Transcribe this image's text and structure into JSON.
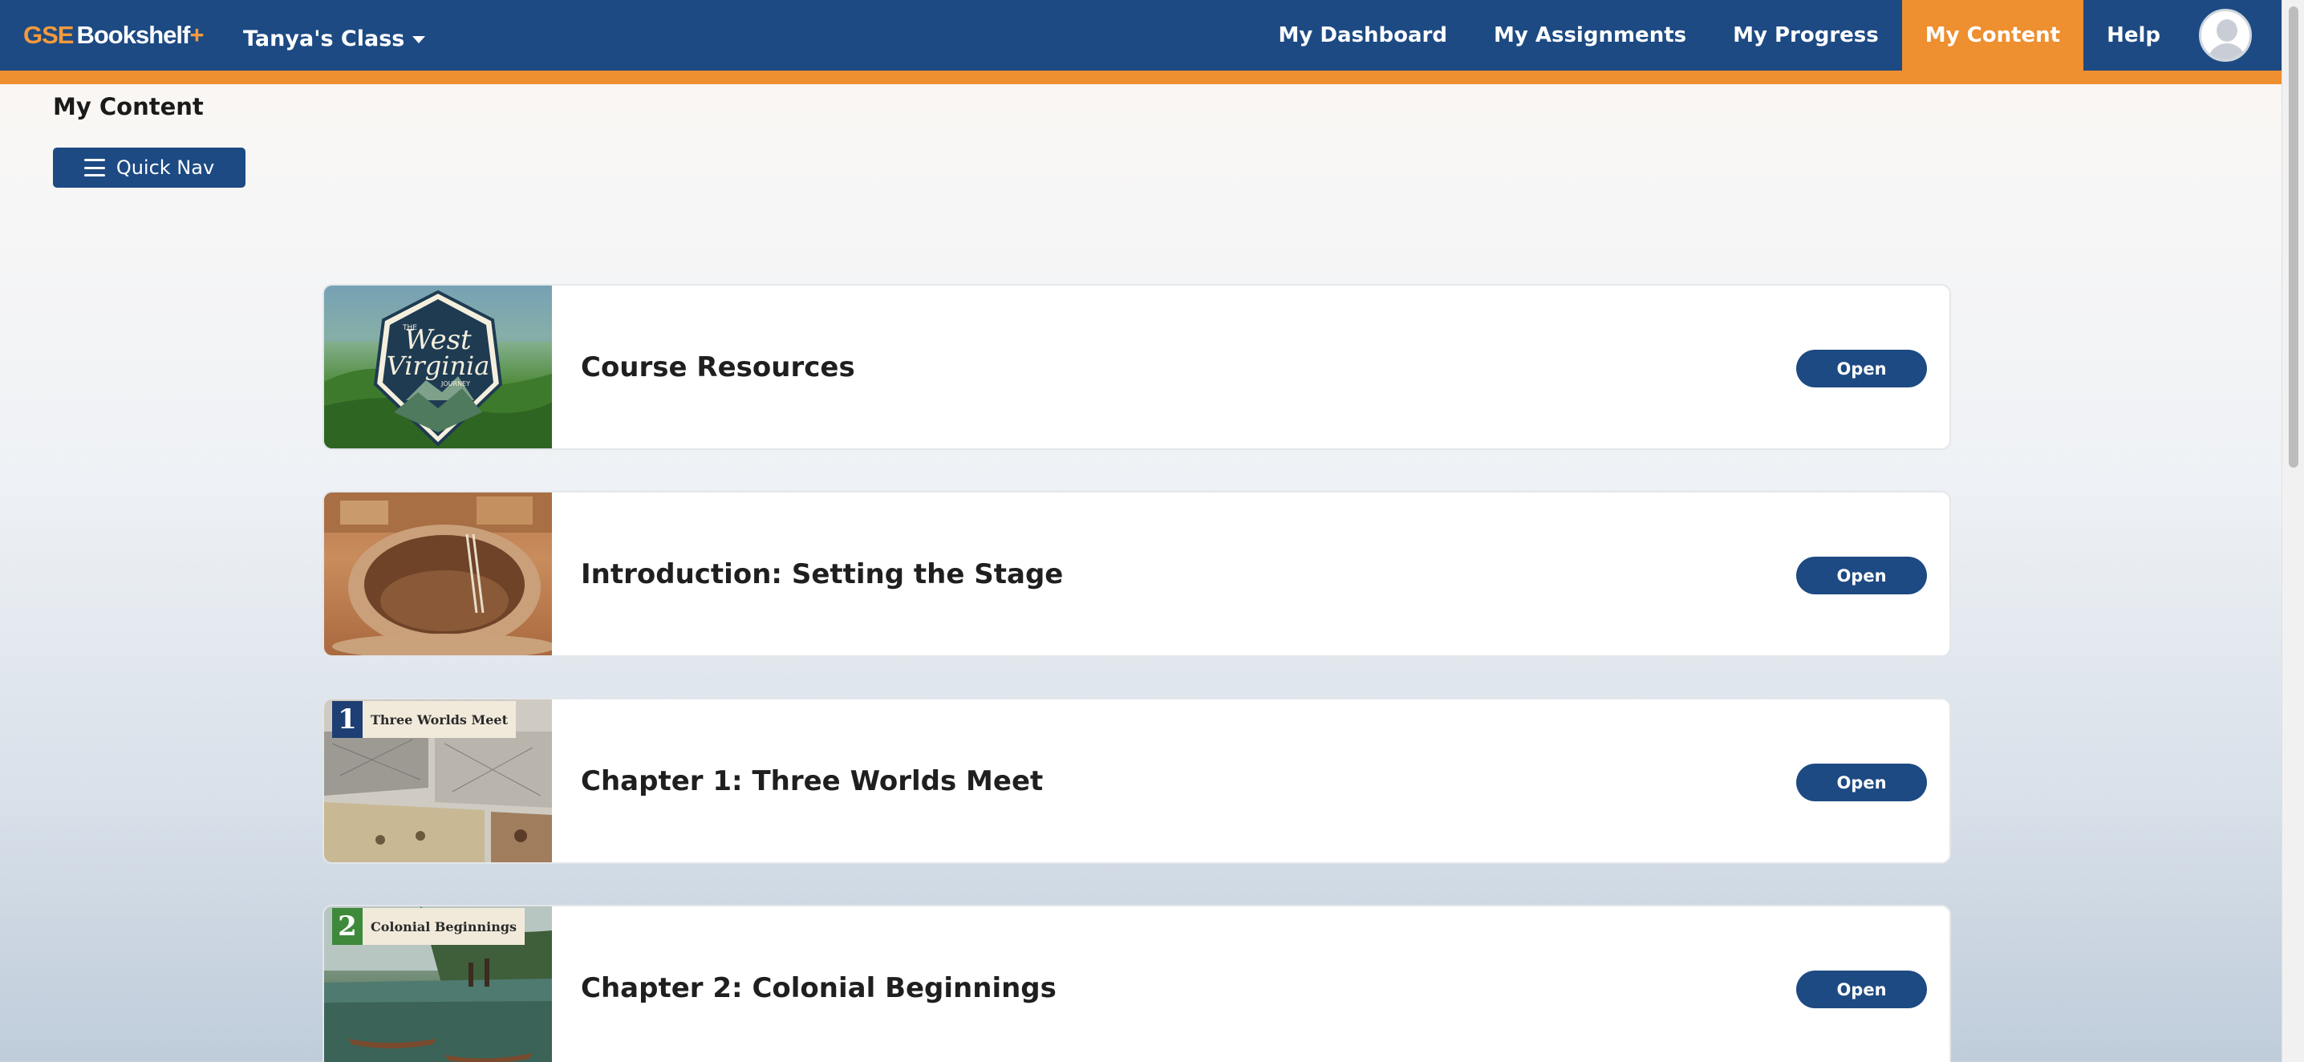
{
  "header": {
    "logo_prefix": "GSE",
    "logo_main": "Bookshelf",
    "logo_suffix": "+",
    "class_name": "Tanya's Class",
    "nav": [
      {
        "label": "My Dashboard",
        "active": false
      },
      {
        "label": "My Assignments",
        "active": false
      },
      {
        "label": "My Progress",
        "active": false
      },
      {
        "label": "My Content",
        "active": true
      },
      {
        "label": "Help",
        "active": false
      }
    ]
  },
  "page": {
    "title": "My Content",
    "quick_nav_label": "Quick Nav"
  },
  "content_items": [
    {
      "title": "Course Resources",
      "button": "Open",
      "thumbnail": "west-virginia-journey-badge",
      "thumb_text": [
        "THE",
        "West",
        "Virginia",
        "JOURNEY"
      ]
    },
    {
      "title": "Introduction: Setting the Stage",
      "button": "Open",
      "thumbnail": "cliff-dwelling-kiva-photo"
    },
    {
      "title": "Chapter 1: Three Worlds Meet",
      "button": "Open",
      "thumbnail": "chapter-1-collage",
      "chapter_number": "1",
      "chapter_name": "Three Worlds Meet"
    },
    {
      "title": "Chapter 2: Colonial Beginnings",
      "button": "Open",
      "thumbnail": "chapter-2-painting",
      "chapter_number": "2",
      "chapter_name": "Colonial Beginnings"
    }
  ],
  "colors": {
    "nav_blue": "#1d4a83",
    "accent_orange": "#ee8f30",
    "chapter1_tab": "#1d3f73",
    "chapter2_tab": "#3e8a3a"
  }
}
